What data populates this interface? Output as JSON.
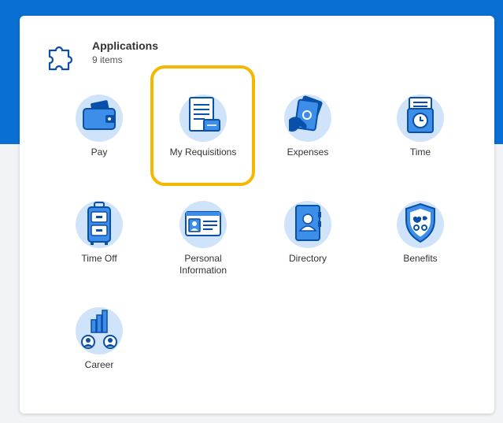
{
  "section": {
    "title": "Applications",
    "count": "9 items"
  },
  "apps": [
    {
      "label": "Pay",
      "icon": "wallet-icon"
    },
    {
      "label": "My Requisitions",
      "icon": "requisition-document-icon"
    },
    {
      "label": "Expenses",
      "icon": "hand-cash-icon"
    },
    {
      "label": "Time",
      "icon": "clock-calendar-icon"
    },
    {
      "label": "Time Off",
      "icon": "luggage-icon"
    },
    {
      "label": "Personal\nInformation",
      "icon": "id-card-icon"
    },
    {
      "label": "Directory",
      "icon": "address-book-icon"
    },
    {
      "label": "Benefits",
      "icon": "shield-icon"
    },
    {
      "label": "Career",
      "icon": "career-ladder-icon"
    }
  ],
  "colors": {
    "brand_blue": "#0a6fd3",
    "highlight": "#f5b800",
    "icon_light": "#cfe3fa",
    "icon_dark": "#0a4fa8"
  }
}
